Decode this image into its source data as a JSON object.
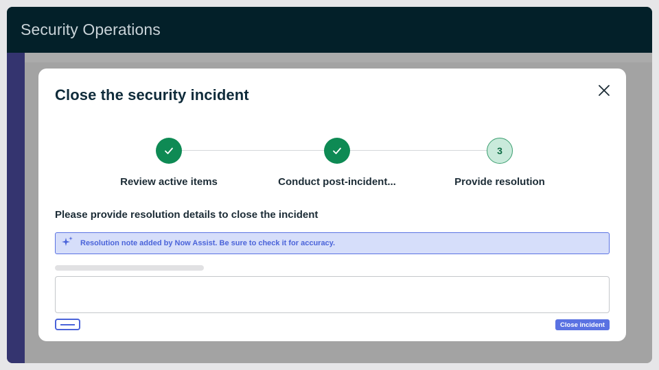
{
  "app": {
    "title": "Security Operations"
  },
  "modal": {
    "title": "Close the security incident",
    "close_icon": "close-x-icon",
    "steps": [
      {
        "label": "Review active items",
        "status": "complete",
        "icon": "check-icon"
      },
      {
        "label": "Conduct post-incident...",
        "status": "complete",
        "icon": "check-icon"
      },
      {
        "label": "Provide resolution",
        "status": "current",
        "number": "3"
      }
    ],
    "instruction": "Please provide resolution details to close the incident",
    "assist_banner": {
      "icon": "sparkle-icon",
      "text": "Resolution note added by Now Assist. Be sure to check it for accuracy."
    },
    "resolution_input": {
      "value": "",
      "placeholder": ""
    },
    "primary_button": "Close incident"
  },
  "colors": {
    "header_bg": "#032029",
    "side_rail": "#34346f",
    "step_complete": "#0e8a54",
    "step_current_fill": "#c9eadb",
    "accent_blue": "#4a63d9",
    "banner_bg": "#d6defa"
  }
}
